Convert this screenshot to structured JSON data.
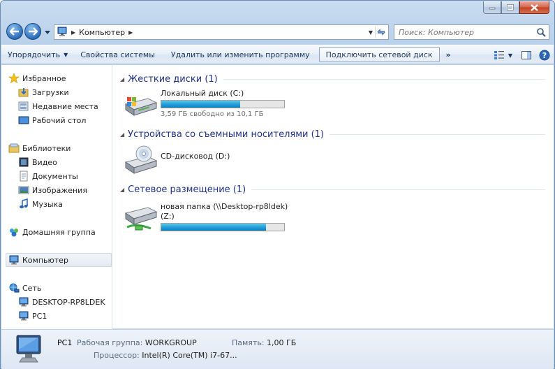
{
  "address": {
    "crumbs": [
      "Компьютер"
    ],
    "search_placeholder": "Поиск: Компьютер"
  },
  "toolbar": {
    "organize": "Упорядочить",
    "system_properties": "Свойства системы",
    "uninstall": "Удалить или изменить программу",
    "map_drive": "Подключить сетевой диск",
    "more": "»"
  },
  "nav": {
    "favorites": {
      "label": "Избранное",
      "items": [
        "Загрузки",
        "Недавние места",
        "Рабочий стол"
      ]
    },
    "libraries": {
      "label": "Библиотеки",
      "items": [
        "Видео",
        "Документы",
        "Изображения",
        "Музыка"
      ]
    },
    "homegroup": "Домашняя группа",
    "computer": "Компьютер",
    "network": {
      "label": "Сеть",
      "items": [
        "DESKTOP-RP8LDEK",
        "PC1"
      ]
    }
  },
  "sections": {
    "hard_disks": "Жесткие диски (1)",
    "removable": "Устройства со съемными носителями (1)",
    "network_location": "Сетевое размещение (1)"
  },
  "drives": {
    "local": {
      "name": "Локальный диск (C:)",
      "free_text": "3,59 ГБ свободно из 10,1 ГБ",
      "used_fraction": 0.64
    },
    "cd": {
      "name": "CD-дисковод (D:)"
    },
    "net": {
      "name": "новая папка (\\\\Desktop-rp8ldek)",
      "letter": "(Z:)",
      "used_fraction": 0.85
    }
  },
  "details": {
    "pc_name": "PC1",
    "workgroup_label": "Рабочая группа:",
    "workgroup_value": "WORKGROUP",
    "memory_label": "Память:",
    "memory_value": "1,00 ГБ",
    "cpu_label": "Процессор:",
    "cpu_value": "Intel(R) Core(TM) i7-67..."
  }
}
